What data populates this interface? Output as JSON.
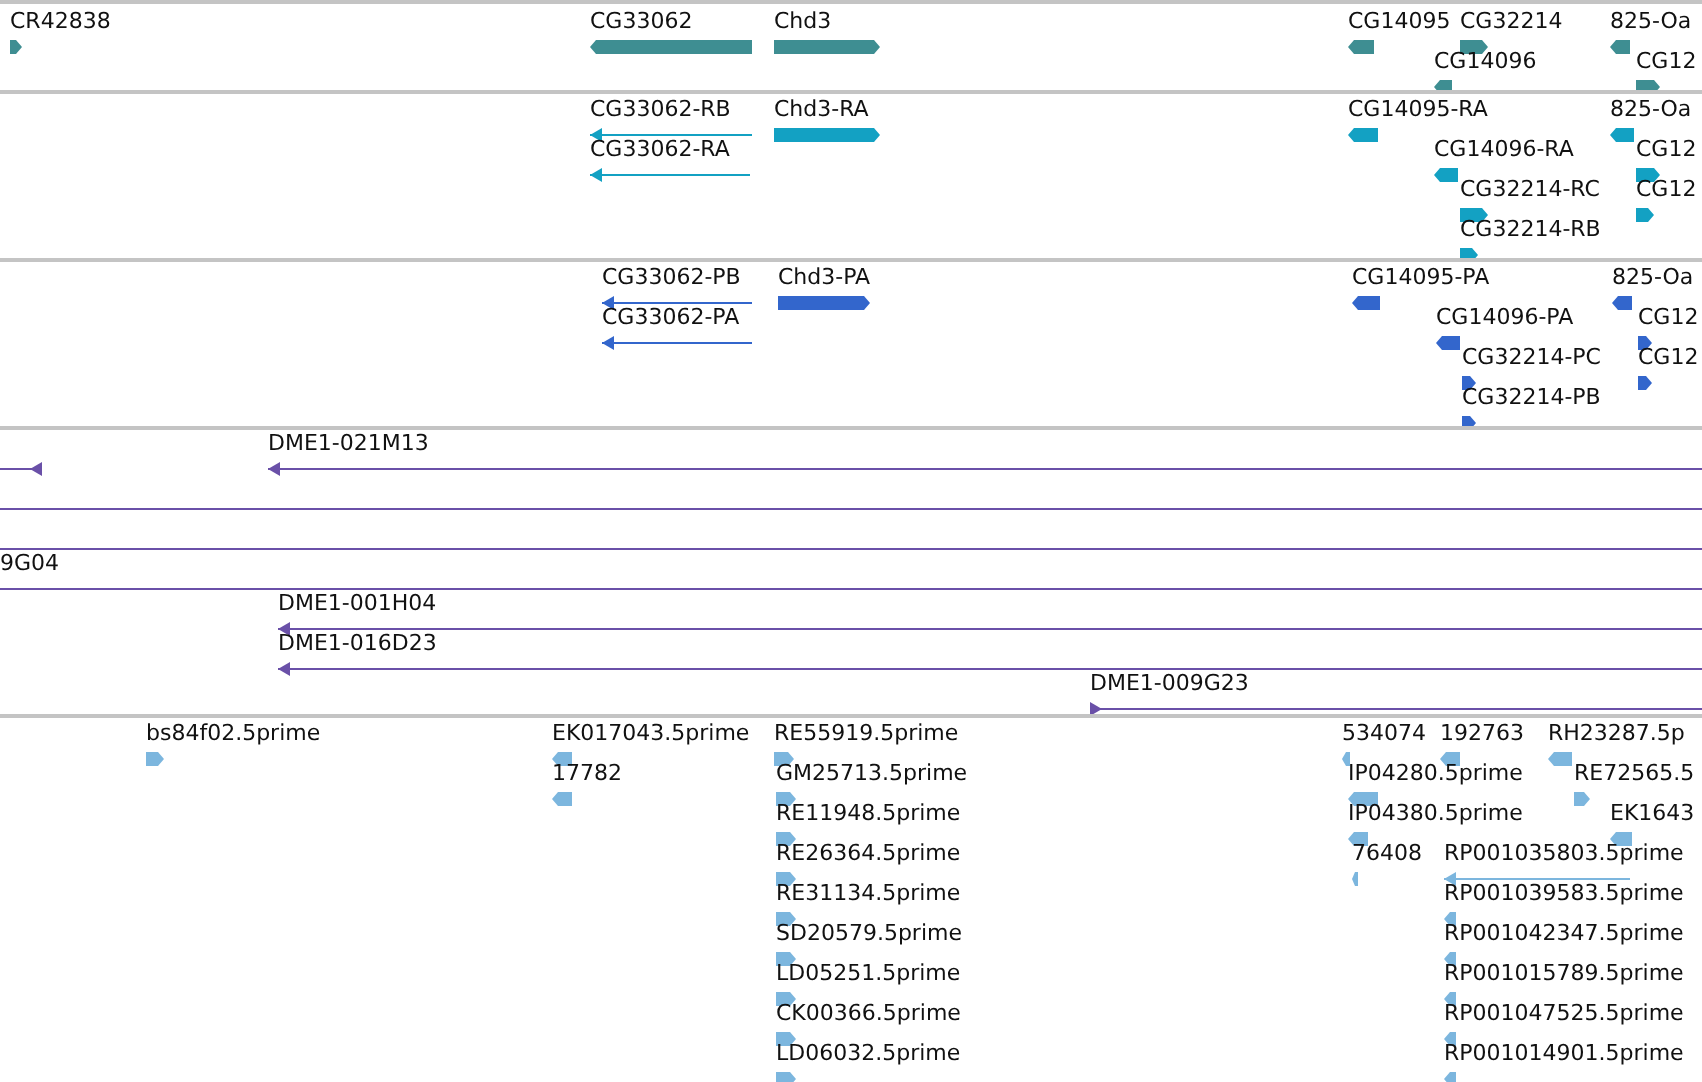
{
  "tracks": [
    {
      "kind": "gene",
      "features": [
        {
          "label": "CR42838",
          "reverse": false
        },
        {
          "label": "CG33062",
          "reverse": true
        },
        {
          "label": "Chd3",
          "reverse": false
        },
        {
          "label": "CG14095",
          "reverse": true
        },
        {
          "label": "CG32214",
          "reverse": false
        },
        {
          "label": "825-Oa",
          "reverse": true
        },
        {
          "label": "CG14096",
          "reverse": true
        },
        {
          "label": "CG12",
          "reverse": false
        }
      ]
    },
    {
      "kind": "transcript",
      "features": [
        {
          "label": "CG33062-RB",
          "reverse": true
        },
        {
          "label": "Chd3-RA",
          "reverse": false
        },
        {
          "label": "CG14095-RA",
          "reverse": true
        },
        {
          "label": "825-Oa",
          "reverse": true
        },
        {
          "label": "CG33062-RA",
          "reverse": true
        },
        {
          "label": "CG14096-RA",
          "reverse": true
        },
        {
          "label": "CG12",
          "reverse": false
        },
        {
          "label": "CG32214-RC",
          "reverse": false
        },
        {
          "label": "CG12",
          "reverse": false
        },
        {
          "label": "CG32214-RB",
          "reverse": false
        }
      ]
    },
    {
      "kind": "protein",
      "features": [
        {
          "label": "CG33062-PB",
          "reverse": true
        },
        {
          "label": "Chd3-PA",
          "reverse": false
        },
        {
          "label": "CG14095-PA",
          "reverse": true
        },
        {
          "label": "825-Oa",
          "reverse": true
        },
        {
          "label": "CG33062-PA",
          "reverse": true
        },
        {
          "label": "CG14096-PA",
          "reverse": true
        },
        {
          "label": "CG12",
          "reverse": false
        },
        {
          "label": "CG32214-PC",
          "reverse": false
        },
        {
          "label": "CG12",
          "reverse": false
        },
        {
          "label": "CG32214-PB",
          "reverse": false
        }
      ]
    },
    {
      "kind": "clone",
      "features": [
        {
          "kind": "clone",
          "reverse": true
        },
        {
          "kind": "clone",
          "label": "DME1-021M13",
          "reverse": true
        },
        {
          "kind": "span"
        },
        {
          "kind": "span"
        },
        {
          "kind": "span",
          "label": "9G04"
        },
        {
          "kind": "clone",
          "label": "DME1-001H04",
          "reverse": true
        },
        {
          "kind": "clone",
          "label": "DME1-016D23",
          "reverse": true
        },
        {
          "kind": "clone",
          "label": "DME1-009G23",
          "reverse": false
        }
      ]
    },
    {
      "kind": "est",
      "features": [
        {
          "label": "bs84f02.5prime",
          "reverse": false
        },
        {
          "label": "EK017043.5prime",
          "reverse": true
        },
        {
          "label": "RE55919.5prime",
          "reverse": false
        },
        {
          "label": "534074",
          "reverse": true
        },
        {
          "label": "192763",
          "reverse": true
        },
        {
          "label": "RH23287.5p",
          "reverse": true
        },
        {
          "label": "17782",
          "reverse": true
        },
        {
          "label": "GM25713.5prime",
          "reverse": false
        },
        {
          "label": "IP04280.5prime",
          "reverse": true
        },
        {
          "label": "RE72565.5",
          "reverse": false
        },
        {
          "label": "RE11948.5prime",
          "reverse": false
        },
        {
          "label": "IP04380.5prime",
          "reverse": true
        },
        {
          "label": "EK1643",
          "reverse": true
        },
        {
          "label": "RE26364.5prime",
          "reverse": false
        },
        {
          "label": "76408",
          "reverse": true
        },
        {
          "label": "RP001035803.5prime",
          "reverse": true
        },
        {
          "label": "RE31134.5prime",
          "reverse": false
        },
        {
          "label": "RP001039583.5prime",
          "reverse": true
        },
        {
          "label": "SD20579.5prime",
          "reverse": false
        },
        {
          "label": "RP001042347.5prime",
          "reverse": true
        },
        {
          "label": "LD05251.5prime",
          "reverse": false
        },
        {
          "label": "RP001015789.5prime",
          "reverse": true
        },
        {
          "label": "CK00366.5prime",
          "reverse": false
        },
        {
          "label": "RP001047525.5prime",
          "reverse": true
        },
        {
          "label": "LD06032.5prime",
          "reverse": false
        },
        {
          "label": "RP001014901.5prime",
          "reverse": true
        }
      ]
    }
  ]
}
